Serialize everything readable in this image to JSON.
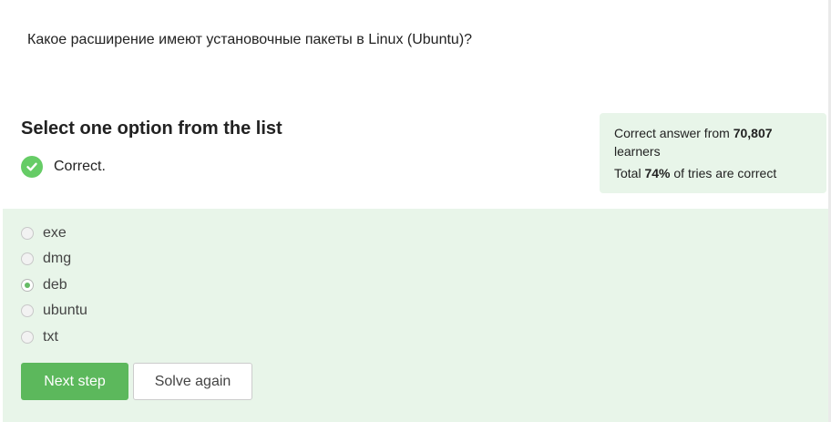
{
  "question": {
    "text": "Какое расширение имеют установочные пакеты в Linux (Ubuntu)?"
  },
  "instructions": {
    "title": "Select one option from the list"
  },
  "status": {
    "icon": "check-circle-icon",
    "text": "Correct.",
    "color": "#66cc66"
  },
  "stats": {
    "line1_prefix": "Correct answer from ",
    "learners_count": "70,807",
    "line1_suffix": "learners",
    "line2_prefix": "Total ",
    "percent_correct": "74%",
    "line2_suffix": " of tries are correct"
  },
  "options": {
    "selected": "deb",
    "items": [
      {
        "label": "exe",
        "selected": false
      },
      {
        "label": "dmg",
        "selected": false
      },
      {
        "label": "deb",
        "selected": true
      },
      {
        "label": "ubuntu",
        "selected": false
      },
      {
        "label": "txt",
        "selected": false
      }
    ]
  },
  "buttons": {
    "next_label": "Next step",
    "solve_again_label": "Solve again"
  },
  "colors": {
    "accent_green": "#5cb85c",
    "panel_background": "#e8f5e9"
  }
}
